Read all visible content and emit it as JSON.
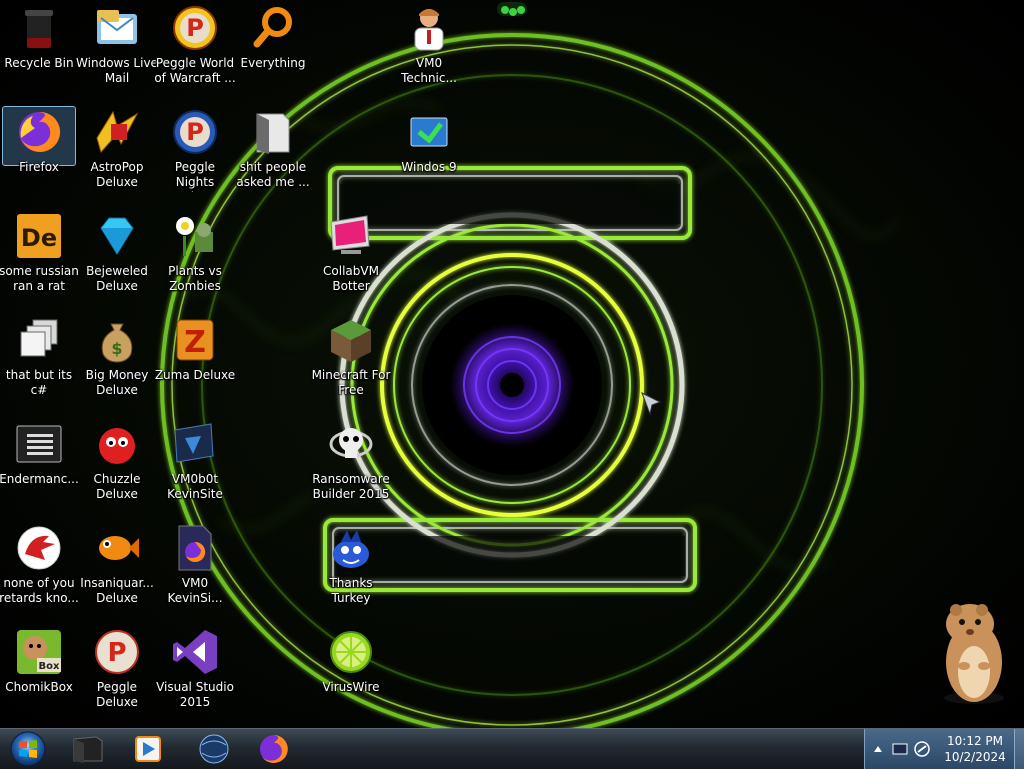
{
  "desktop": {
    "icons": [
      {
        "label": "Recycle Bin"
      },
      {
        "label": "Windows Live Mail"
      },
      {
        "label": "Peggle World of Warcraft ..."
      },
      {
        "label": "Everything"
      },
      {
        "label": "VM0 Technic..."
      },
      {
        "label": "Firefox"
      },
      {
        "label": "AstroPop Deluxe"
      },
      {
        "label": "Peggle Nights Deluxe"
      },
      {
        "label": "shit people asked me ..."
      },
      {
        "label": "Windos 9"
      },
      {
        "label": "some russian ran a rat"
      },
      {
        "label": "Bejeweled Deluxe"
      },
      {
        "label": "Plants vs Zombies"
      },
      {
        "label": "CollabVM Botter"
      },
      {
        "label": "that but its c#"
      },
      {
        "label": "Big Money Deluxe"
      },
      {
        "label": "Zuma Deluxe"
      },
      {
        "label": "Minecraft For Free"
      },
      {
        "label": "Endermanc..."
      },
      {
        "label": "Chuzzle Deluxe"
      },
      {
        "label": "VM0b0t KevinSite"
      },
      {
        "label": "Ransomware Builder 2015"
      },
      {
        "label": "none of you retards kno..."
      },
      {
        "label": "Insaniquar... Deluxe"
      },
      {
        "label": "VM0 KevinSi..."
      },
      {
        "label": "Thanks Turkey"
      },
      {
        "label": "ChomikBox"
      },
      {
        "label": "Peggle Deluxe"
      },
      {
        "label": "Visual Studio 2015"
      },
      {
        "label": "VirusWire"
      }
    ]
  },
  "taskbar": {
    "apps": [
      "explorer-folder-icon",
      "media-player-icon",
      "globe-app-icon",
      "firefox-icon"
    ],
    "clock": {
      "time": "10:12 PM",
      "date": "10/2/2024"
    }
  },
  "colors": {
    "accent_green": "#8be029",
    "accent_purple": "#6a2ad8",
    "taskbar": "#222a31",
    "tray": "#2a4766"
  }
}
